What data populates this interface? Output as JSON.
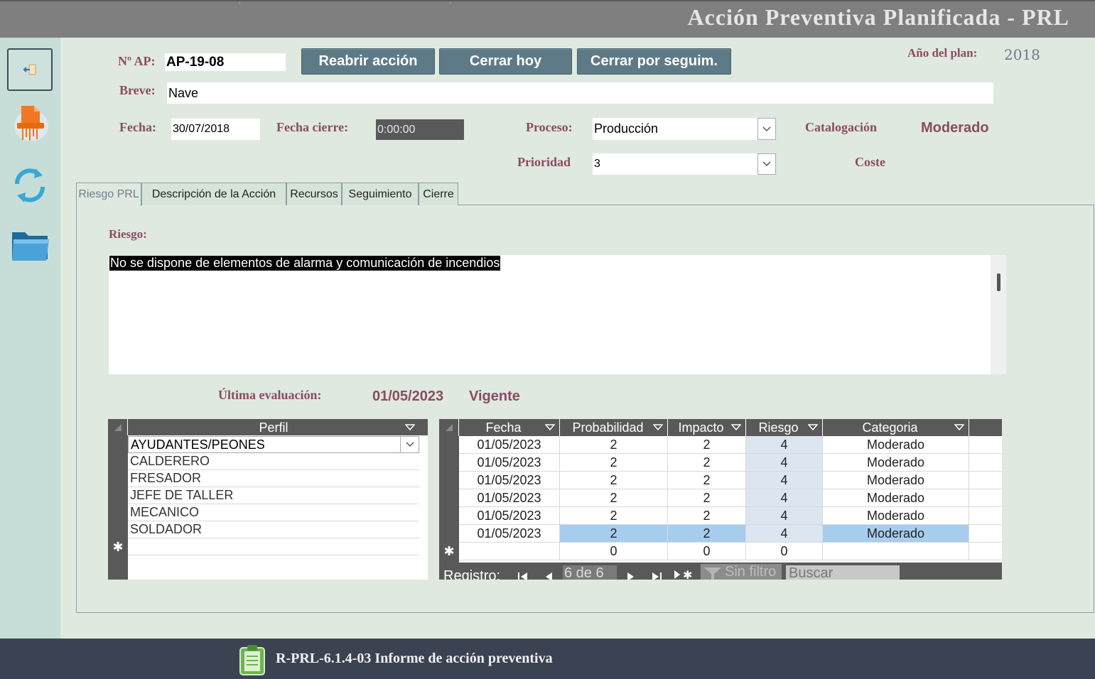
{
  "app": {
    "title": "Acción Preventiva Planificada - PRL"
  },
  "header": {
    "nap_label": "Nº AP:",
    "nap_value": "AP-19-08",
    "buttons": {
      "reabrir": "Reabrir acción",
      "cerrar_hoy": "Cerrar hoy",
      "cerrar_seguim": "Cerrar por seguim."
    },
    "anio_label": "Año del plan:",
    "anio_value": "2018",
    "breve_label": "Breve:",
    "breve_value": "Nave",
    "fecha_label": "Fecha:",
    "fecha_value": "30/07/2018",
    "fecha_cierre_label": "Fecha cierre:",
    "fecha_cierre_value": "0:00:00",
    "proceso_label": "Proceso:",
    "proceso_value": "Producción",
    "catalogacion_label": "Catalogación",
    "catalogacion_value": "Moderado",
    "prioridad_label": "Prioridad",
    "prioridad_value": "3",
    "coste_label": "Coste"
  },
  "tabs": [
    "Riesgo PRL",
    "Descripción de la Acción",
    "Recursos",
    "Seguimiento",
    "Cierre"
  ],
  "riesgo": {
    "label": "Riesgo:",
    "text": "No se dispone de elementos de alarma y comunicación de incendios",
    "ultima_label": "Última evaluación:",
    "ultima_fecha": "01/05/2023",
    "estado": "Vigente"
  },
  "perfil": {
    "header": "Perfil",
    "rows": [
      "AYUDANTES/PEONES",
      "CALDERERO",
      "FRESADOR",
      "JEFE DE TALLER",
      "MECANICO",
      "SOLDADOR"
    ],
    "new_row_marker": "✱"
  },
  "evaluaciones": {
    "headers": [
      "Fecha",
      "Probabilidad",
      "Impacto",
      "Riesgo",
      "Categoria"
    ],
    "rows": [
      [
        "01/05/2023",
        "2",
        "2",
        "4",
        "Moderado"
      ],
      [
        "01/05/2023",
        "2",
        "2",
        "4",
        "Moderado"
      ],
      [
        "01/05/2023",
        "2",
        "2",
        "4",
        "Moderado"
      ],
      [
        "01/05/2023",
        "2",
        "2",
        "4",
        "Moderado"
      ],
      [
        "01/05/2023",
        "2",
        "2",
        "4",
        "Moderado"
      ],
      [
        "01/05/2023",
        "2",
        "2",
        "4",
        "Moderado"
      ]
    ],
    "new_row": [
      "",
      "0",
      "0",
      "0",
      ""
    ],
    "new_row_marker": "✱",
    "nav": {
      "label": "Registro:",
      "position": "6 de 6",
      "filter": "Sin filtro",
      "search": "Buscar"
    }
  },
  "footer": {
    "report_label": "R-PRL-6.1.4-03 Informe de acción preventiva"
  },
  "colors": {
    "accent_text": "#8a4b62",
    "button": "#5e7a87",
    "sidebar": "#c6ddd8",
    "background": "#dfe9e0",
    "footer": "#3b4352"
  }
}
